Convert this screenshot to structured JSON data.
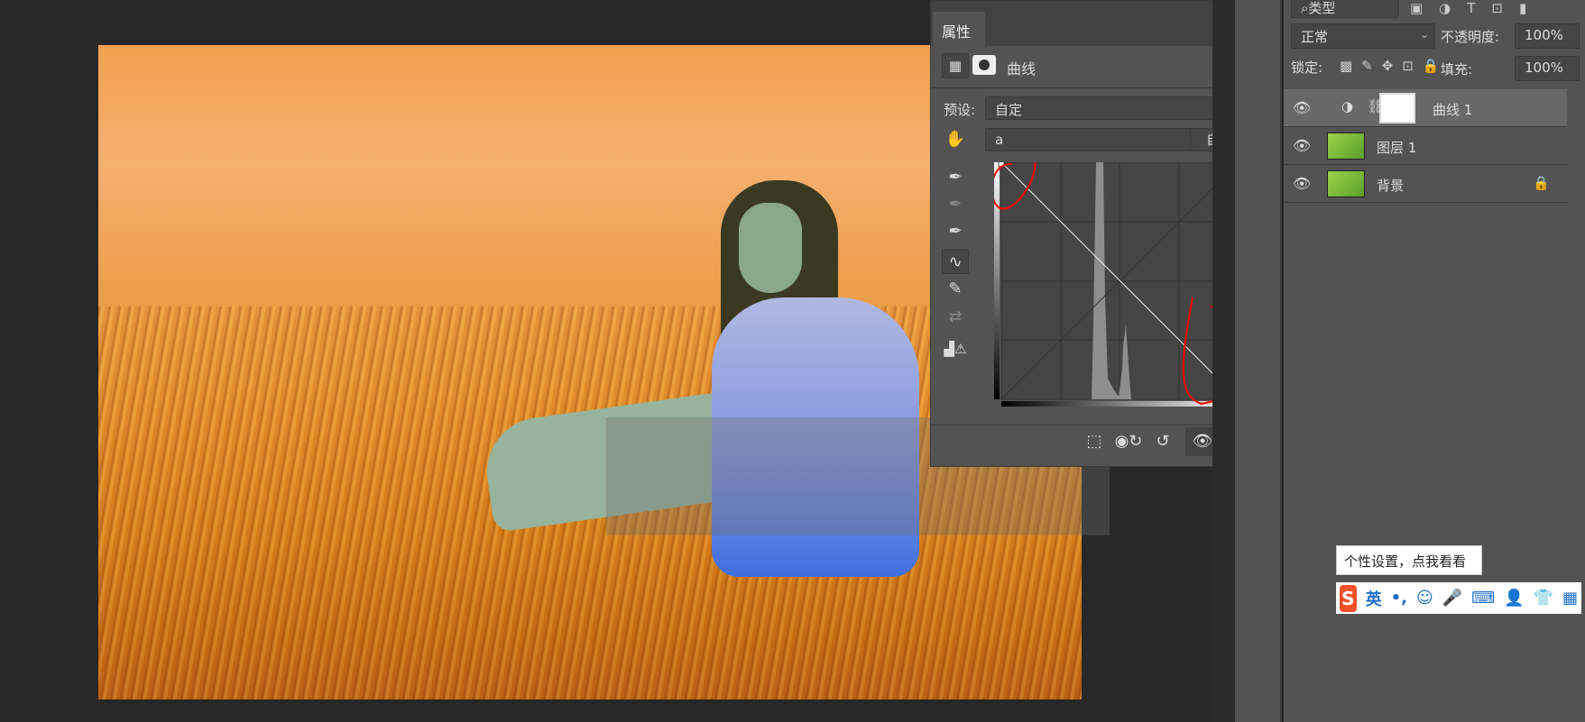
{
  "properties": {
    "tab": "属性",
    "type": "曲线",
    "preset_label": "预设:",
    "preset_value": "自定",
    "channel_value": "a",
    "auto_label": "自动"
  },
  "layers": {
    "filter": "类型",
    "blend_mode": "正常",
    "opacity_label": "不透明度:",
    "opacity_value": "100%",
    "lock_label": "锁定:",
    "fill_label": "填充:",
    "fill_value": "100%",
    "items": [
      {
        "name": "曲线 1"
      },
      {
        "name": "图层 1"
      },
      {
        "name": "背景"
      }
    ]
  },
  "tooltip": "个性设置，点我看看",
  "ime": {
    "mode": "英"
  },
  "colors": {
    "panel": "#535353",
    "annotation": "#ff0000"
  }
}
